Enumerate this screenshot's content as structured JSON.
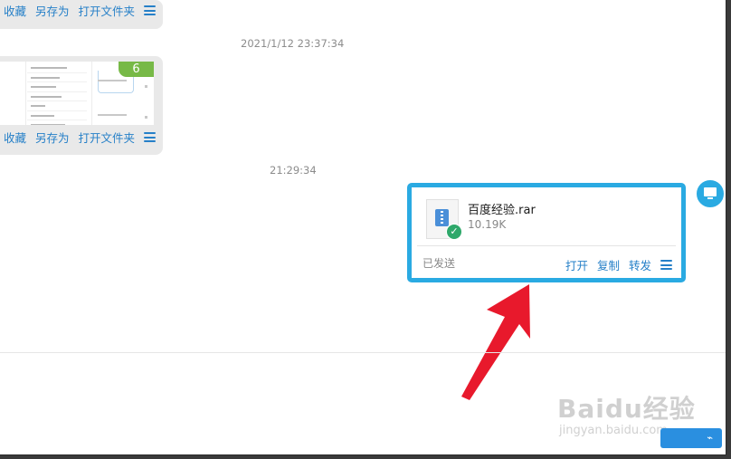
{
  "messages": [
    {
      "actions": [
        "收藏",
        "另存为",
        "打开文件夹"
      ]
    },
    {
      "timestamp": "2021/1/12 23:37:34",
      "preview_badge": "6",
      "actions": [
        "收藏",
        "另存为",
        "打开文件夹"
      ]
    }
  ],
  "sent_file": {
    "timestamp": "21:29:34",
    "name": "百度经验.rar",
    "size": "10.19K",
    "status": "已发送",
    "actions": [
      "打开",
      "复制",
      "转发"
    ]
  },
  "watermark": {
    "main": "Baidu经验",
    "sub": "jingyan.baidu.com"
  },
  "icons": {
    "menu": "hamburger-icon",
    "file": "zip-archive-icon",
    "check": "check-circle-icon",
    "avatar": "monitor-icon"
  },
  "colors": {
    "highlight_border": "#2aaae2",
    "action_link": "#2680c8",
    "badge": "#77b947",
    "arrow": "#e8192c"
  }
}
